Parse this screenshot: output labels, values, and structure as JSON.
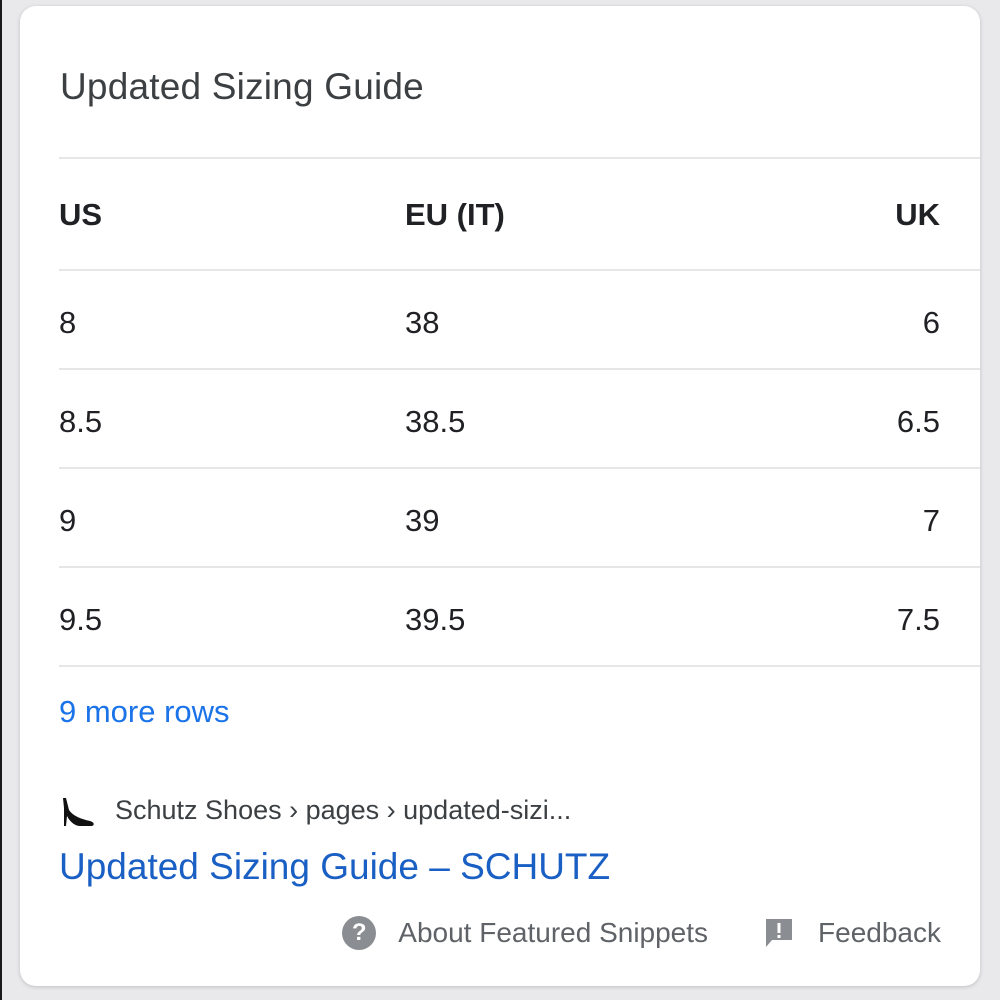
{
  "card": {
    "title": "Updated Sizing Guide"
  },
  "table": {
    "headers": [
      "US",
      "EU (IT)",
      "UK"
    ],
    "rows": [
      [
        "8",
        "38",
        "6"
      ],
      [
        "8.5",
        "38.5",
        "6.5"
      ],
      [
        "9",
        "39",
        "7"
      ],
      [
        "9.5",
        "39.5",
        "7.5"
      ]
    ],
    "more_rows_label": "9 more rows"
  },
  "source": {
    "breadcrumb": "Schutz Shoes › pages › updated-sizi...",
    "favicon_icon": "high-heel-shoe-icon",
    "link_title": "Updated Sizing Guide – SCHUTZ"
  },
  "footer": {
    "about_label": "About Featured Snippets",
    "about_icon": "question-circle-icon",
    "feedback_label": "Feedback",
    "feedback_icon": "feedback-flag-icon"
  },
  "colors": {
    "link": "#1a73e8",
    "title_text": "#3c4043",
    "muted_text": "#5f6368"
  }
}
